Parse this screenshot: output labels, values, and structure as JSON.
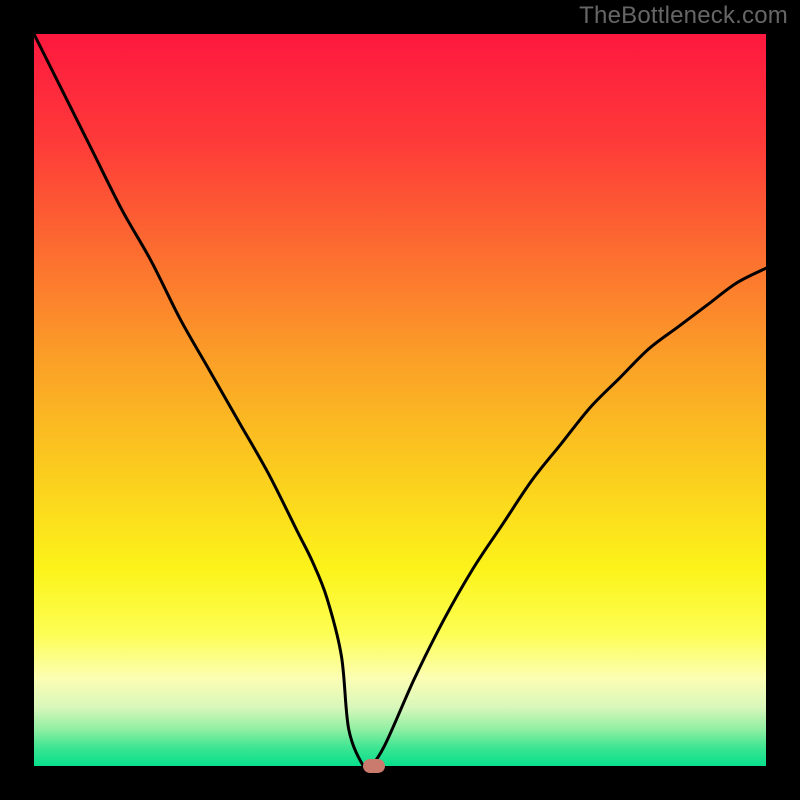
{
  "watermark": "TheBottleneck.com",
  "chart_data": {
    "type": "line",
    "title": "",
    "xlabel": "",
    "ylabel": "",
    "xlim": [
      0,
      100
    ],
    "ylim": [
      0,
      100
    ],
    "grid": false,
    "series": [
      {
        "name": "bottleneck-curve",
        "x": [
          0,
          4,
          8,
          12,
          16,
          20,
          24,
          28,
          32,
          36,
          38,
          40,
          42,
          43,
          45,
          46,
          48,
          52,
          56,
          60,
          64,
          68,
          72,
          76,
          80,
          84,
          88,
          92,
          96,
          100
        ],
        "y": [
          100,
          92,
          84,
          76,
          69,
          61,
          54,
          47,
          40,
          32,
          28,
          23,
          15,
          5,
          0,
          0,
          3,
          12,
          20,
          27,
          33,
          39,
          44,
          49,
          53,
          57,
          60,
          63,
          66,
          68
        ]
      }
    ],
    "annotations": [
      {
        "name": "optimal-point",
        "x": 46.5,
        "y": 0,
        "color": "#cb7a6e"
      }
    ],
    "background": {
      "type": "vertical-gradient",
      "stops": [
        {
          "offset": 0.0,
          "color": "#fe183f"
        },
        {
          "offset": 0.15,
          "color": "#fe3b39"
        },
        {
          "offset": 0.3,
          "color": "#fc6e30"
        },
        {
          "offset": 0.45,
          "color": "#fba127"
        },
        {
          "offset": 0.6,
          "color": "#fbcd1e"
        },
        {
          "offset": 0.73,
          "color": "#fcf31a"
        },
        {
          "offset": 0.82,
          "color": "#fdfe54"
        },
        {
          "offset": 0.88,
          "color": "#fcfeb3"
        },
        {
          "offset": 0.92,
          "color": "#d8f7bb"
        },
        {
          "offset": 0.95,
          "color": "#90efa2"
        },
        {
          "offset": 0.975,
          "color": "#3de592"
        },
        {
          "offset": 1.0,
          "color": "#06df8c"
        }
      ]
    }
  }
}
